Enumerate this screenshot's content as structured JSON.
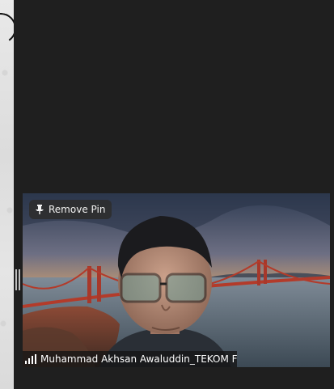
{
  "video": {
    "pin_button": {
      "label": "Remove Pin",
      "icon": "pin-icon"
    },
    "participant_name": "Muhammad Akhsan Awaluddin_TEKOM F",
    "connection_icon": "signal-strength-icon"
  },
  "colors": {
    "background": "#1f1f1f",
    "pin_button_bg": "#2d2d2d",
    "name_bar_bg": "#141414"
  }
}
